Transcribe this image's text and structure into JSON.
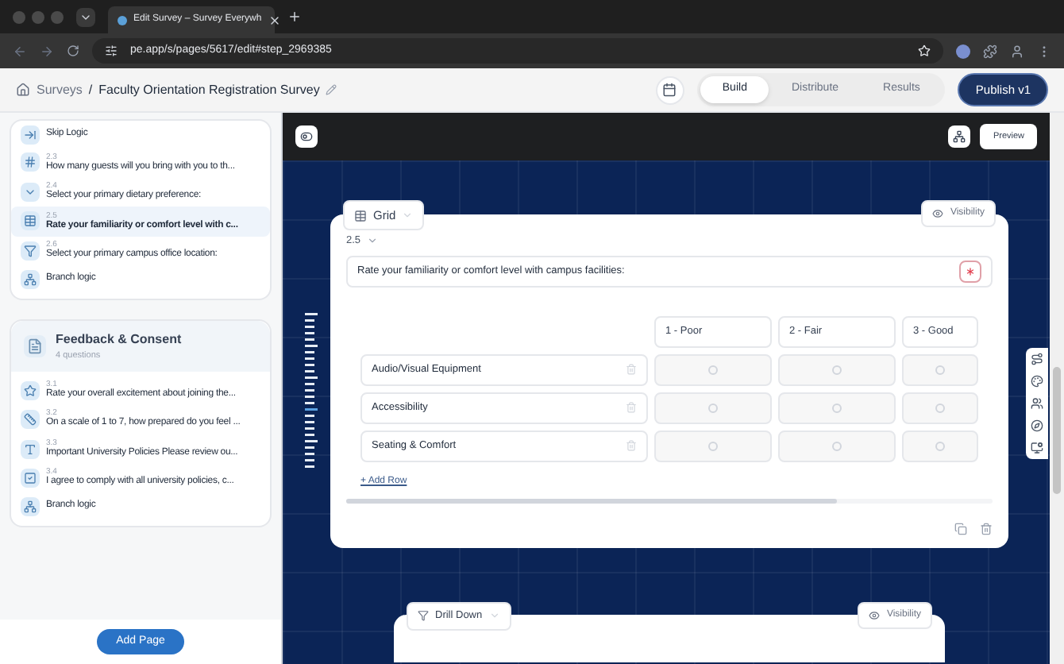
{
  "browser": {
    "tab_title": "Edit Survey – Survey Everywh",
    "url": "pe.app/s/pages/5617/edit#step_2969385"
  },
  "header": {
    "breadcrumb_root": "Surveys",
    "separator": "/",
    "survey_title": "Faculty Orientation Registration Survey",
    "tabs": [
      {
        "label": "Build",
        "selected": true
      },
      {
        "label": "Distribute",
        "selected": false
      },
      {
        "label": "Results",
        "selected": false
      }
    ],
    "publish": "Publish v1"
  },
  "sidebar": {
    "sections": [
      {
        "items": [
          {
            "kind": "skip",
            "label": "Skip Logic",
            "selected": false
          },
          {
            "kind": "number",
            "number": "2.3",
            "label": "How many guests will you bring with you to th...",
            "selected": false
          },
          {
            "kind": "dropdown",
            "number": "2.4",
            "label": "Select your primary dietary preference:",
            "selected": false
          },
          {
            "kind": "grid",
            "number": "2.5",
            "label": "Rate your familiarity or comfort level with c...",
            "selected": true
          },
          {
            "kind": "filter",
            "number": "2.6",
            "label": "Select your primary campus office location:",
            "selected": false
          },
          {
            "kind": "branch",
            "label": "Branch logic",
            "selected": false
          }
        ]
      },
      {
        "title": "Feedback & Consent",
        "subtitle": "4 questions",
        "items": [
          {
            "kind": "star",
            "number": "3.1",
            "label": "Rate your overall excitement about joining the...",
            "selected": false
          },
          {
            "kind": "scale",
            "number": "3.2",
            "label": "On a scale of 1 to 7, how prepared do you feel ...",
            "selected": false
          },
          {
            "kind": "text",
            "number": "3.3",
            "label": "Important University Policies Please review ou...",
            "selected": false
          },
          {
            "kind": "consent",
            "number": "3.4",
            "label": "I agree to comply with all university policies, c...",
            "selected": false
          },
          {
            "kind": "branch",
            "label": "Branch logic",
            "selected": false
          }
        ]
      }
    ],
    "add_page": "Add Page"
  },
  "toolbar": {
    "preview": "Preview"
  },
  "question": {
    "type": "Grid",
    "visibility": "Visibility",
    "number": "2.5",
    "text": "Rate your familiarity or comfort level with campus facilities:",
    "required": true,
    "columns": [
      "1 - Poor",
      "2 - Fair",
      "3 - Good"
    ],
    "rows": [
      {
        "label": "Audio/Visual Equipment",
        "choices": [
          false,
          false,
          false
        ]
      },
      {
        "label": "Accessibility",
        "choices": [
          false,
          false,
          false
        ]
      },
      {
        "label": "Seating & Comfort",
        "choices": [
          false,
          false,
          false
        ]
      }
    ],
    "add_row": "+ Add Row"
  },
  "next_question": {
    "type": "Drill Down",
    "visibility": "Visibility"
  }
}
